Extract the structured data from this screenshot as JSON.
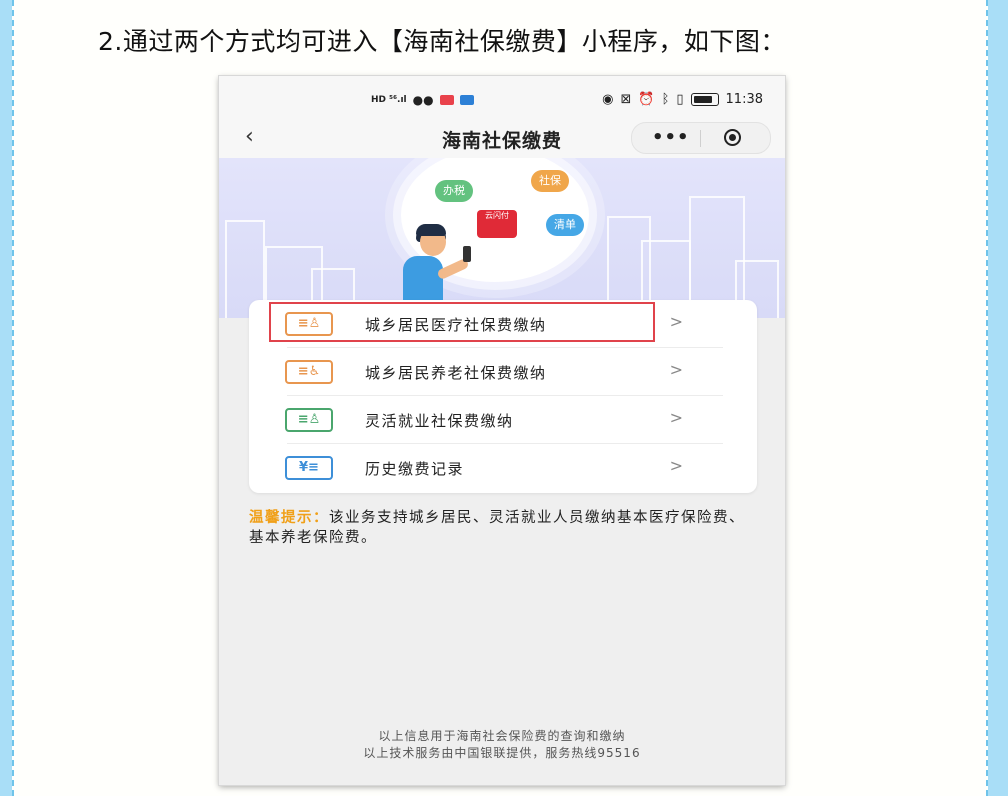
{
  "heading": "2.通过两个方式均可进入【海南社保缴费】小程序，如下图：",
  "status_bar": {
    "left_indicators": "HD ⁵⁶.ıl",
    "time": "11:38"
  },
  "nav": {
    "back_icon": "‹",
    "title": "海南社保缴费",
    "more_label": "•••"
  },
  "banner": {
    "tag_banshui": "办税",
    "tag_shebao": "社保",
    "tag_qingdan": "清单",
    "logo_text": "云闪付"
  },
  "menu": {
    "items": [
      {
        "icon": "≡♙",
        "icon_name": "resident-card-icon",
        "label": "城乡居民医疗社保费缴纳",
        "arrow": ">",
        "highlighted": true
      },
      {
        "icon": "≡♿",
        "icon_name": "elderly-card-icon",
        "label": "城乡居民养老社保费缴纳",
        "arrow": ">",
        "highlighted": false
      },
      {
        "icon": "≡♙",
        "icon_name": "flexible-employment-icon",
        "label": "灵活就业社保费缴纳",
        "arrow": ">",
        "highlighted": false
      },
      {
        "icon": "¥≡",
        "icon_name": "payment-record-icon",
        "label": "历史缴费记录",
        "arrow": ">",
        "highlighted": false
      }
    ]
  },
  "tips": {
    "label": "温馨提示：",
    "text": "该业务支持城乡居民、灵活就业人员缴纳基本医疗保险费、基本养老保险费。"
  },
  "footer": {
    "line1": "以上信息用于海南社会保险费的查询和缴纳",
    "line2": "以上技术服务由中国银联提供，服务热线95516"
  },
  "colors": {
    "accent_orange": "#e8964f",
    "accent_green": "#4aa66d",
    "accent_blue": "#3d8fd8",
    "highlight_red": "#e0434b",
    "tips_label": "#f0a019"
  }
}
